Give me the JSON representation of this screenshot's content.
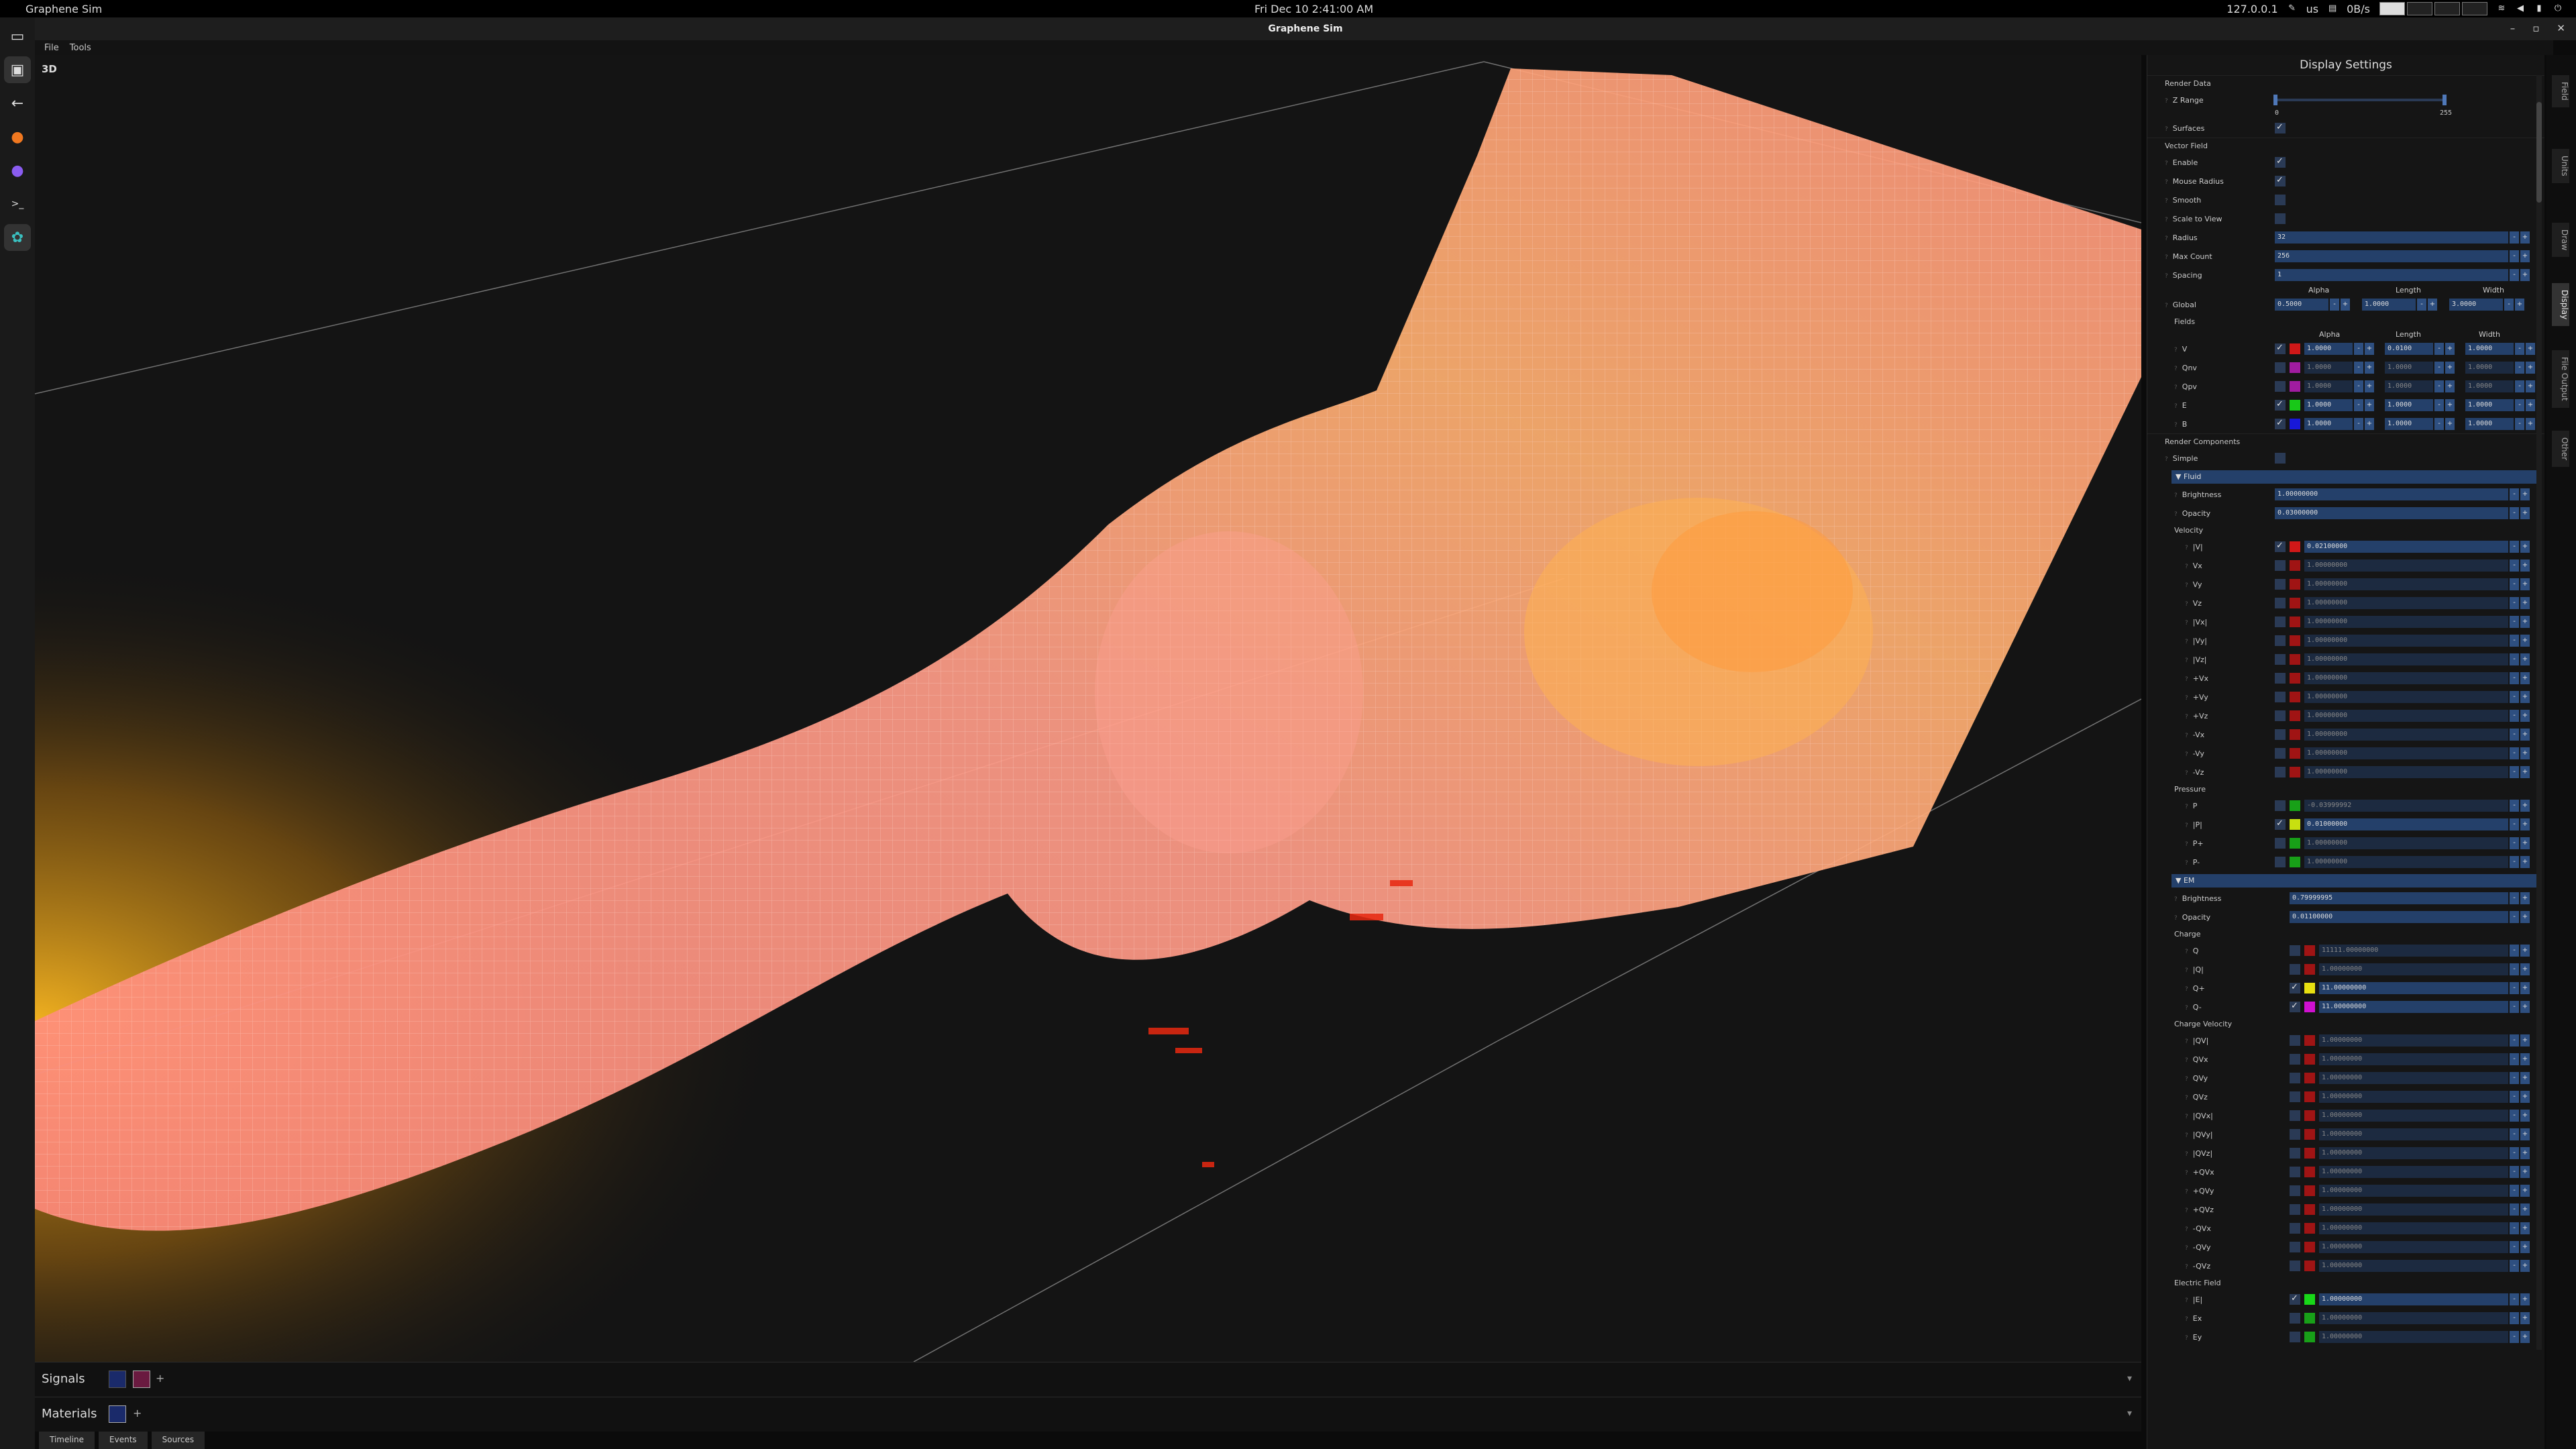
{
  "system_bar": {
    "app_name": "Graphene Sim",
    "clock": "Fri Dec 10  2:41:00 AM",
    "ip": "127.0.0.1",
    "keyboard": "us",
    "net_speed": "0B/s"
  },
  "window": {
    "title": "Graphene Sim"
  },
  "menu": [
    "File",
    "Tools"
  ],
  "viewport": {
    "label": "3D"
  },
  "bottom": {
    "signals_label": "Signals",
    "materials_label": "Materials",
    "tabs": [
      "Timeline",
      "Events",
      "Sources"
    ]
  },
  "right_tabs": [
    "Field",
    "Units",
    "Draw",
    "Display",
    "File Output",
    "Other"
  ],
  "panel": {
    "title": "Display Settings",
    "render_data": {
      "label": "Render Data",
      "z_range_label": "Z Range",
      "z_min": "0",
      "z_max": "255",
      "surfaces_label": "Surfaces"
    },
    "vector_field": {
      "label": "Vector Field",
      "enable": "Enable",
      "mouse_radius": "Mouse Radius",
      "smooth": "Smooth",
      "scale_to_view": "Scale to View",
      "radius_label": "Radius",
      "radius": "32",
      "max_count_label": "Max Count",
      "max_count": "256",
      "spacing_label": "Spacing",
      "spacing": "1",
      "col_alpha": "Alpha",
      "col_length": "Length",
      "col_width": "Width",
      "global_label": "Global",
      "global_alpha": "0.5000",
      "global_length": "1.0000",
      "global_width": "3.0000"
    },
    "fields": {
      "label": "Fields",
      "rows": [
        {
          "name": "V",
          "on": true,
          "color": "#d01818",
          "alpha": "1.0000",
          "length": "0.0100",
          "width": "1.0000"
        },
        {
          "name": "Qnv",
          "on": false,
          "color": "#a01ca0",
          "alpha": "1.0000",
          "length": "1.0000",
          "width": "1.0000"
        },
        {
          "name": "Qpv",
          "on": false,
          "color": "#a01ca0",
          "alpha": "1.0000",
          "length": "1.0000",
          "width": "1.0000"
        },
        {
          "name": "E",
          "on": true,
          "color": "#18c818",
          "alpha": "1.0000",
          "length": "1.0000",
          "width": "1.0000"
        },
        {
          "name": "B",
          "on": true,
          "color": "#1818d8",
          "alpha": "1.0000",
          "length": "1.0000",
          "width": "1.0000"
        }
      ]
    },
    "render_components": {
      "label": "Render Components",
      "simple": "Simple",
      "fluid": {
        "header": "Fluid",
        "brightness_label": "Brightness",
        "brightness": "1.00000000",
        "opacity_label": "Opacity",
        "opacity": "0.03000000",
        "velocity_label": "Velocity",
        "velocity_rows": [
          {
            "name": "|V|",
            "on": true,
            "color": "#d01818",
            "value": "0.02100000"
          },
          {
            "name": "Vx",
            "on": false,
            "color": "#a01414",
            "value": "1.00000000"
          },
          {
            "name": "Vy",
            "on": false,
            "color": "#a01414",
            "value": "1.00000000"
          },
          {
            "name": "Vz",
            "on": false,
            "color": "#a01414",
            "value": "1.00000000"
          },
          {
            "name": "|Vx|",
            "on": false,
            "color": "#a01414",
            "value": "1.00000000"
          },
          {
            "name": "|Vy|",
            "on": false,
            "color": "#a01414",
            "value": "1.00000000"
          },
          {
            "name": "|Vz|",
            "on": false,
            "color": "#a01414",
            "value": "1.00000000"
          },
          {
            "name": "+Vx",
            "on": false,
            "color": "#a01414",
            "value": "1.00000000"
          },
          {
            "name": "+Vy",
            "on": false,
            "color": "#a01414",
            "value": "1.00000000"
          },
          {
            "name": "+Vz",
            "on": false,
            "color": "#a01414",
            "value": "1.00000000"
          },
          {
            "name": "-Vx",
            "on": false,
            "color": "#a01414",
            "value": "1.00000000"
          },
          {
            "name": "-Vy",
            "on": false,
            "color": "#a01414",
            "value": "1.00000000"
          },
          {
            "name": "-Vz",
            "on": false,
            "color": "#a01414",
            "value": "1.00000000"
          }
        ],
        "pressure_label": "Pressure",
        "pressure_rows": [
          {
            "name": "P",
            "on": false,
            "color": "#18a018",
            "value": "-0.03999992"
          },
          {
            "name": "|P|",
            "on": true,
            "color": "#c8e010",
            "value": "0.01000000"
          },
          {
            "name": "P+",
            "on": false,
            "color": "#18a018",
            "value": "1.00000000"
          },
          {
            "name": "P-",
            "on": false,
            "color": "#18a018",
            "value": "1.00000000"
          }
        ]
      },
      "em": {
        "header": "EM",
        "brightness_label": "Brightness",
        "brightness": "0.79999995",
        "opacity_label": "Opacity",
        "opacity": "0.01100000",
        "charge_label": "Charge",
        "charge_rows": [
          {
            "name": "Q",
            "on": false,
            "color": "#a01414",
            "value": "11111.00000000"
          },
          {
            "name": "|Q|",
            "on": false,
            "color": "#a01414",
            "value": "1.00000000"
          },
          {
            "name": "Q+",
            "on": true,
            "color": "#e8e010",
            "value": "11.00000000"
          },
          {
            "name": "Q-",
            "on": true,
            "color": "#d010d0",
            "value": "11.00000000"
          }
        ],
        "charge_velocity_label": "Charge Velocity",
        "charge_velocity_rows": [
          {
            "name": "|QV|",
            "on": false,
            "color": "#a01414",
            "value": "1.00000000"
          },
          {
            "name": "QVx",
            "on": false,
            "color": "#a01414",
            "value": "1.00000000"
          },
          {
            "name": "QVy",
            "on": false,
            "color": "#a01414",
            "value": "1.00000000"
          },
          {
            "name": "QVz",
            "on": false,
            "color": "#a01414",
            "value": "1.00000000"
          },
          {
            "name": "|QVx|",
            "on": false,
            "color": "#a01414",
            "value": "1.00000000"
          },
          {
            "name": "|QVy|",
            "on": false,
            "color": "#a01414",
            "value": "1.00000000"
          },
          {
            "name": "|QVz|",
            "on": false,
            "color": "#a01414",
            "value": "1.00000000"
          },
          {
            "name": "+QVx",
            "on": false,
            "color": "#a01414",
            "value": "1.00000000"
          },
          {
            "name": "+QVy",
            "on": false,
            "color": "#a01414",
            "value": "1.00000000"
          },
          {
            "name": "+QVz",
            "on": false,
            "color": "#a01414",
            "value": "1.00000000"
          },
          {
            "name": "-QVx",
            "on": false,
            "color": "#a01414",
            "value": "1.00000000"
          },
          {
            "name": "-QVy",
            "on": false,
            "color": "#a01414",
            "value": "1.00000000"
          },
          {
            "name": "-QVz",
            "on": false,
            "color": "#a01414",
            "value": "1.00000000"
          }
        ],
        "electric_field_label": "Electric Field",
        "electric_field_rows": [
          {
            "name": "|E|",
            "on": true,
            "color": "#18d818",
            "value": "1.00000000"
          },
          {
            "name": "Ex",
            "on": false,
            "color": "#18a018",
            "value": "1.00000000"
          },
          {
            "name": "Ey",
            "on": false,
            "color": "#18a018",
            "value": "1.00000000"
          }
        ]
      }
    }
  }
}
